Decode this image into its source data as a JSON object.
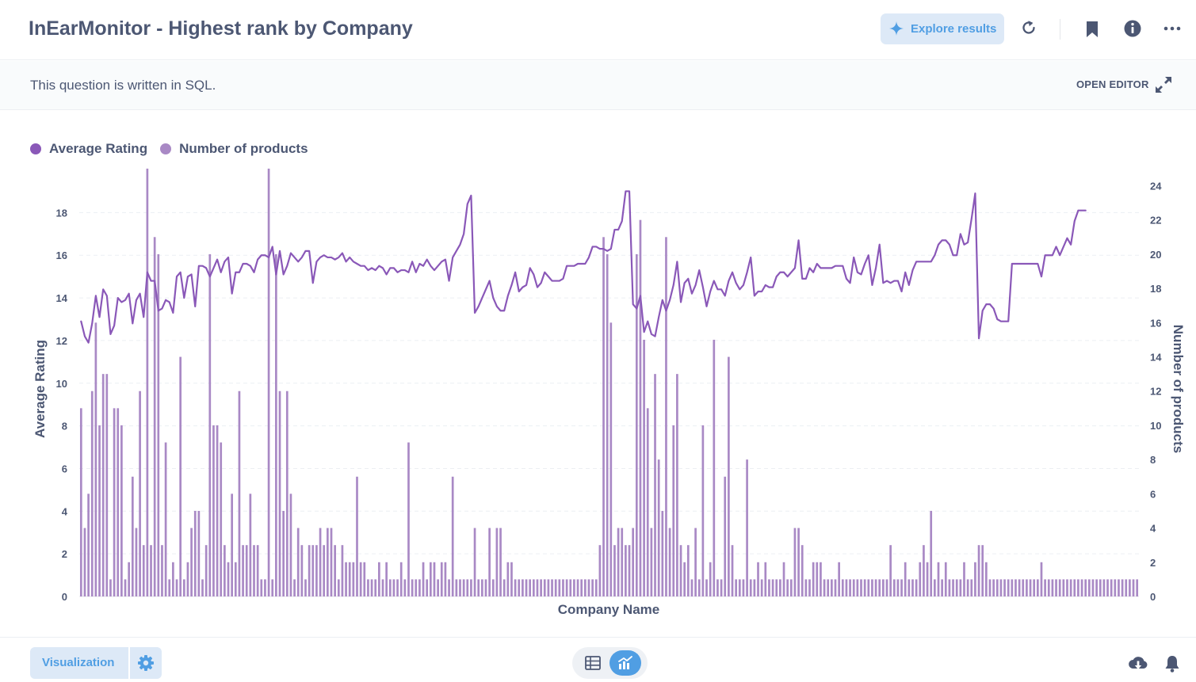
{
  "header": {
    "title": "InEarMonitor - Highest rank by Company",
    "explore_label": "Explore results",
    "icons": [
      "sparkle-icon",
      "refresh-icon",
      "bookmark-icon",
      "info-icon",
      "more-icon"
    ]
  },
  "sql_bar": {
    "message": "This question is written in SQL.",
    "open_editor_label": "OPEN EDITOR",
    "icon": "expand-icon"
  },
  "footer": {
    "visualization_label": "Visualization",
    "icons": [
      "gear-icon",
      "table-icon",
      "chart-icon",
      "download-icon",
      "bell-icon"
    ]
  },
  "colors": {
    "accent": "#509ee3",
    "accent_light": "#dde9f7",
    "line_series": "#8a58b8",
    "bar_series": "#a989c5",
    "text": "#4c5773"
  },
  "chart_data": {
    "type": "bar",
    "title": "",
    "xlabel": "Company Name",
    "ylabel": "Average Rating",
    "y2label": "Number of products",
    "ylim": [
      0,
      19.5
    ],
    "y2lim": [
      0,
      24.3
    ],
    "yticks": [
      "0",
      "2",
      "4",
      "6",
      "8",
      "10",
      "12",
      "14",
      "16",
      "18"
    ],
    "y2ticks": [
      "0",
      "2",
      "4",
      "6",
      "8",
      "10",
      "12",
      "14",
      "16",
      "18",
      "20",
      "22",
      "24"
    ],
    "grid": true,
    "legend_position": "top-left",
    "x_tick_labels_visible": false,
    "series": [
      {
        "name": "Average Rating",
        "type": "line",
        "axis": "left",
        "color": "#8a58b8",
        "values": [
          12.9,
          12.2,
          11.9,
          12.8,
          14.1,
          13.1,
          14.4,
          14.1,
          12.3,
          12.7,
          14.0,
          13.8,
          13.9,
          14.2,
          12.8,
          13.9,
          14.2,
          13.1,
          15.2,
          14.8,
          14.8,
          13.4,
          13.5,
          13.9,
          13.8,
          13.3,
          15.0,
          15.2,
          14.0,
          15.0,
          15.1,
          13.6,
          15.5,
          15.5,
          15.4,
          15.0,
          15.4,
          15.8,
          15.2,
          15.7,
          15.9,
          14.2,
          15.2,
          15.2,
          15.6,
          15.6,
          15.5,
          15.2,
          15.8,
          16.0,
          16.0,
          15.9,
          16.4,
          15.1,
          16.2,
          15.1,
          15.5,
          16.1,
          15.9,
          15.7,
          15.9,
          16.2,
          16.2,
          14.7,
          15.7,
          15.9,
          16.0,
          15.9,
          15.9,
          15.8,
          15.9,
          16.1,
          15.7,
          15.9,
          15.7,
          15.6,
          15.5,
          15.5,
          15.3,
          15.4,
          15.3,
          15.5,
          15.4,
          15.1,
          15.4,
          15.4,
          15.2,
          15.3,
          15.3,
          15.2,
          15.7,
          15.2,
          15.6,
          15.5,
          15.8,
          15.5,
          15.3,
          15.5,
          15.7,
          15.8,
          14.8,
          15.9,
          16.2,
          16.5,
          17.0,
          18.4,
          18.8,
          13.3,
          13.6,
          14.0,
          14.4,
          14.8,
          14.0,
          13.6,
          13.4,
          13.4,
          14.1,
          14.6,
          15.2,
          14.3,
          14.5,
          14.6,
          15.4,
          15.1,
          14.5,
          14.7,
          15.2,
          15.0,
          14.8,
          14.8,
          14.8,
          14.9,
          15.5,
          15.5,
          15.5,
          15.6,
          15.6,
          15.6,
          15.9,
          16.4,
          16.4,
          16.3,
          16.3,
          16.2,
          16.3,
          17.2,
          17.2,
          17.6,
          19.0,
          19.0,
          13.7,
          13.5,
          14.1,
          12.4,
          12.9,
          12.3,
          12.2,
          13.1,
          13.9,
          13.4,
          13.9,
          14.6,
          15.7,
          13.8,
          14.7,
          14.9,
          14.2,
          14.6,
          15.3,
          14.5,
          13.6,
          14.3,
          14.8,
          14.4,
          14.4,
          14.1,
          14.8,
          15.2,
          14.7,
          14.4,
          14.6,
          15.2,
          15.9,
          14.1,
          14.3,
          14.3,
          14.6,
          14.5,
          14.5,
          15.0,
          15.2,
          15.2,
          15.0,
          15.2,
          15.4,
          16.7,
          14.9,
          14.9,
          15.4,
          15.2,
          15.6,
          15.4,
          15.4,
          15.4,
          15.4,
          15.5,
          15.5,
          15.5,
          14.9,
          14.7,
          15.9,
          15.2,
          15.1,
          15.6,
          16.0,
          14.6,
          15.4,
          16.5,
          14.7,
          14.8,
          14.7,
          14.8,
          14.8,
          14.3,
          15.2,
          14.6,
          15.3,
          15.7,
          15.7,
          15.7,
          15.7,
          15.7,
          16.0,
          16.5,
          16.7,
          16.7,
          16.5,
          16.0,
          16.0,
          17.0,
          16.5,
          16.6,
          17.7,
          18.9,
          12.1,
          13.4,
          13.7,
          13.7,
          13.5,
          13.0,
          12.9,
          12.9,
          12.9,
          15.6,
          15.6,
          15.6,
          15.6,
          15.6,
          15.6,
          15.6,
          15.6,
          15.0,
          16.0,
          16.0,
          16.0,
          16.4,
          16.0,
          16.4,
          16.8,
          16.5,
          17.6,
          18.1,
          18.1,
          18.1
        ]
      },
      {
        "name": "Number of products",
        "type": "bar",
        "axis": "right",
        "color": "#a989c5",
        "values": [
          11,
          4,
          6,
          12,
          16,
          10,
          13,
          13,
          1,
          11,
          11,
          10,
          1,
          2,
          7,
          4,
          12,
          3,
          25,
          3,
          21,
          20,
          3,
          9,
          1,
          2,
          1,
          14,
          1,
          2,
          4,
          5,
          5,
          1,
          3,
          20,
          10,
          10,
          9,
          3,
          2,
          6,
          2,
          12,
          3,
          3,
          6,
          3,
          3,
          1,
          1,
          25,
          1,
          20,
          12,
          5,
          12,
          6,
          1,
          4,
          3,
          1,
          3,
          3,
          3,
          4,
          3,
          4,
          4,
          3,
          1,
          3,
          2,
          2,
          2,
          7,
          2,
          2,
          1,
          1,
          1,
          2,
          1,
          2,
          1,
          1,
          1,
          2,
          1,
          9,
          1,
          1,
          1,
          2,
          1,
          2,
          2,
          1,
          2,
          2,
          1,
          7,
          1,
          1,
          1,
          1,
          1,
          4,
          1,
          1,
          1,
          4,
          1,
          4,
          4,
          1,
          2,
          2,
          1,
          1,
          1,
          1,
          1,
          1,
          1,
          1,
          1,
          1,
          1,
          1,
          1,
          1,
          1,
          1,
          1,
          1,
          1,
          1,
          1,
          1,
          1,
          3,
          21,
          20,
          16,
          3,
          4,
          4,
          3,
          3,
          4,
          20,
          22,
          15,
          11,
          4,
          13,
          8,
          5,
          21,
          4,
          10,
          13,
          3,
          2,
          3,
          1,
          4,
          1,
          10,
          1,
          2,
          15,
          1,
          1,
          7,
          14,
          3,
          1,
          1,
          1,
          8,
          1,
          1,
          2,
          1,
          2,
          1,
          1,
          1,
          1,
          2,
          1,
          1,
          4,
          4,
          3,
          1,
          1,
          2,
          2,
          2,
          1,
          1,
          1,
          1,
          2,
          1,
          1,
          1,
          1,
          1,
          1,
          1,
          1,
          1,
          1,
          1,
          1,
          1,
          3,
          1,
          1,
          1,
          2,
          1,
          1,
          1,
          2,
          3,
          2,
          5,
          1,
          2,
          1,
          2,
          1,
          1,
          1,
          1,
          2,
          1,
          1,
          2,
          3,
          3,
          2,
          1,
          1,
          1,
          1,
          1,
          1,
          1,
          1,
          1,
          1,
          1,
          1,
          1,
          1,
          2,
          1,
          1,
          1,
          1,
          1,
          1,
          1,
          1,
          1,
          1,
          1,
          1,
          1,
          1,
          1,
          1,
          1,
          1,
          1,
          1,
          1,
          1,
          1,
          1,
          1,
          1
        ]
      }
    ]
  }
}
